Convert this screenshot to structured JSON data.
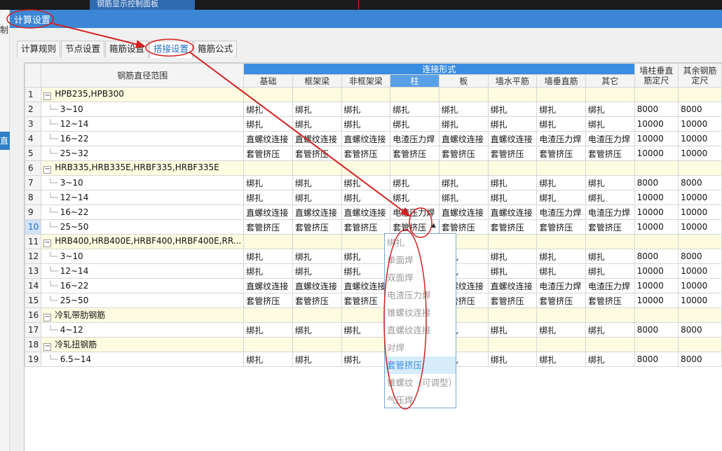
{
  "background": {
    "title": "钢筋显示控制面板",
    "left_chars": [
      "制",
      "直"
    ]
  },
  "window": {
    "title": "计算设置"
  },
  "tabs": [
    {
      "label": "计算规则"
    },
    {
      "label": "节点设置"
    },
    {
      "label": "箍筋设置"
    },
    {
      "label": "搭接设置",
      "active": true
    },
    {
      "label": "箍筋公式"
    }
  ],
  "grid": {
    "header_range": "钢筋直径范围",
    "header_group": "连接形式",
    "columns": [
      "基础",
      "框架梁",
      "非框架梁",
      "柱",
      "板",
      "墙水平筋",
      "墙垂直筋",
      "其它"
    ],
    "col_wall": "墙柱垂直筋定尺",
    "col_other": "其余钢筋定尺",
    "rows": [
      {
        "n": "1",
        "type": "group",
        "label": "HPB235,HPB300"
      },
      {
        "n": "2",
        "label": "3~10",
        "vals": [
          "绑扎",
          "绑扎",
          "绑扎",
          "绑扎",
          "绑扎",
          "绑扎",
          "绑扎",
          "绑扎",
          "8000",
          "8000"
        ]
      },
      {
        "n": "3",
        "label": "12~14",
        "vals": [
          "绑扎",
          "绑扎",
          "绑扎",
          "绑扎",
          "绑扎",
          "绑扎",
          "绑扎",
          "绑扎",
          "10000",
          "10000"
        ]
      },
      {
        "n": "4",
        "label": "16~22",
        "vals": [
          "直螺纹连接",
          "直螺纹连接",
          "直螺纹连接",
          "电渣压力焊",
          "直螺纹连接",
          "直螺纹连接",
          "电渣压力焊",
          "电渣压力焊",
          "10000",
          "10000"
        ]
      },
      {
        "n": "5",
        "label": "25~32",
        "vals": [
          "套管挤压",
          "套管挤压",
          "套管挤压",
          "套管挤压",
          "套管挤压",
          "套管挤压",
          "套管挤压",
          "套管挤压",
          "10000",
          "10000"
        ]
      },
      {
        "n": "6",
        "type": "group",
        "label": "HRB335,HRB335E,HRBF335,HRBF335E"
      },
      {
        "n": "7",
        "label": "3~10",
        "vals": [
          "绑扎",
          "绑扎",
          "绑扎",
          "绑扎",
          "绑扎",
          "绑扎",
          "绑扎",
          "绑扎",
          "8000",
          "8000"
        ]
      },
      {
        "n": "8",
        "label": "12~14",
        "vals": [
          "绑扎",
          "绑扎",
          "绑扎",
          "绑扎",
          "绑扎",
          "绑扎",
          "绑扎",
          "绑扎",
          "10000",
          "10000"
        ]
      },
      {
        "n": "9",
        "label": "16~22",
        "vals": [
          "直螺纹连接",
          "直螺纹连接",
          "直螺纹连接",
          "电渣压力焊",
          "直螺纹连接",
          "直螺纹连接",
          "电渣压力焊",
          "电渣压力焊",
          "10000",
          "10000"
        ]
      },
      {
        "n": "10",
        "label": "25~50",
        "current": true,
        "vals": [
          "套管挤压",
          "套管挤压",
          "套管挤压",
          "套管挤压",
          "套管挤压",
          "套管挤压",
          "套管挤压",
          "套管挤压",
          "10000",
          "10000"
        ]
      },
      {
        "n": "11",
        "type": "group",
        "label": "HRB400,HRB400E,HRBF400,HRBF400E,RR..."
      },
      {
        "n": "12",
        "label": "3~10",
        "vals": [
          "绑扎",
          "绑扎",
          "绑扎",
          "",
          "绑扎",
          "绑扎",
          "绑扎",
          "绑扎",
          "8000",
          "8000"
        ]
      },
      {
        "n": "13",
        "label": "12~14",
        "vals": [
          "绑扎",
          "绑扎",
          "绑扎",
          "",
          "绑扎",
          "绑扎",
          "绑扎",
          "绑扎",
          "10000",
          "10000"
        ]
      },
      {
        "n": "14",
        "label": "16~22",
        "vals": [
          "直螺纹连接",
          "直螺纹连接",
          "直螺纹连接",
          "",
          "直螺纹连接",
          "直螺纹连接",
          "电渣压力焊",
          "电渣压力焊",
          "10000",
          "10000"
        ]
      },
      {
        "n": "15",
        "label": "25~50",
        "vals": [
          "套管挤压",
          "套管挤压",
          "套管挤压",
          "",
          "套管挤压",
          "套管挤压",
          "套管挤压",
          "套管挤压",
          "10000",
          "10000"
        ]
      },
      {
        "n": "16",
        "type": "group",
        "label": "冷轧带肋钢筋"
      },
      {
        "n": "17",
        "label": "4~12",
        "vals": [
          "绑扎",
          "绑扎",
          "绑扎",
          "",
          "绑扎",
          "绑扎",
          "绑扎",
          "绑扎",
          "8000",
          "8000"
        ]
      },
      {
        "n": "18",
        "type": "group",
        "label": "冷轧扭钢筋"
      },
      {
        "n": "19",
        "label": "6.5~14",
        "vals": [
          "绑扎",
          "绑扎",
          "绑扎",
          "",
          "绑扎",
          "绑扎",
          "绑扎",
          "绑扎",
          "8000",
          "8000"
        ]
      }
    ]
  },
  "dropdown": {
    "options": [
      "绑扎",
      "单面焊",
      "双面焊",
      "电渣压力焊",
      "锥螺纹连接",
      "直螺纹连接",
      "对焊",
      "套管挤压",
      "锥螺纹（可调型）",
      "气压焊"
    ],
    "selected": "套管挤压"
  },
  "colors": {
    "annotation": "#d42020",
    "accent": "#3a8de0"
  }
}
